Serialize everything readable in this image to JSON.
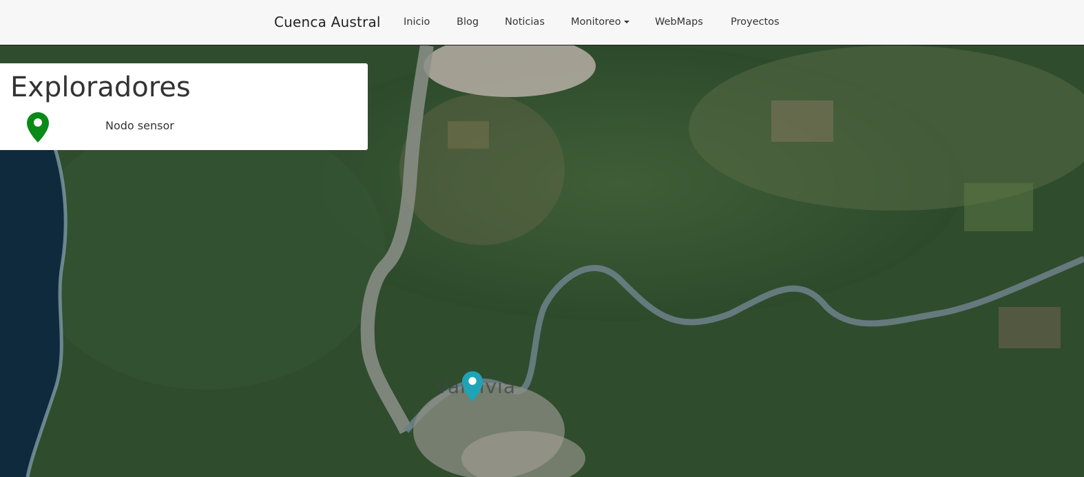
{
  "navbar": {
    "brand": "Cuenca Austral",
    "items": [
      {
        "label": "Inicio"
      },
      {
        "label": "Blog"
      },
      {
        "label": "Noticias"
      },
      {
        "label": "Monitoreo",
        "dropdown": true
      },
      {
        "label": "WebMaps"
      },
      {
        "label": "Proyectos"
      }
    ]
  },
  "legend": {
    "title": "Exploradores",
    "items": [
      {
        "label": "Nodo sensor",
        "icon": "map-marker-icon",
        "color": "#0a8a16"
      }
    ]
  },
  "map": {
    "city_label": "Valdivia",
    "marker_color": "#1fa3b6"
  }
}
